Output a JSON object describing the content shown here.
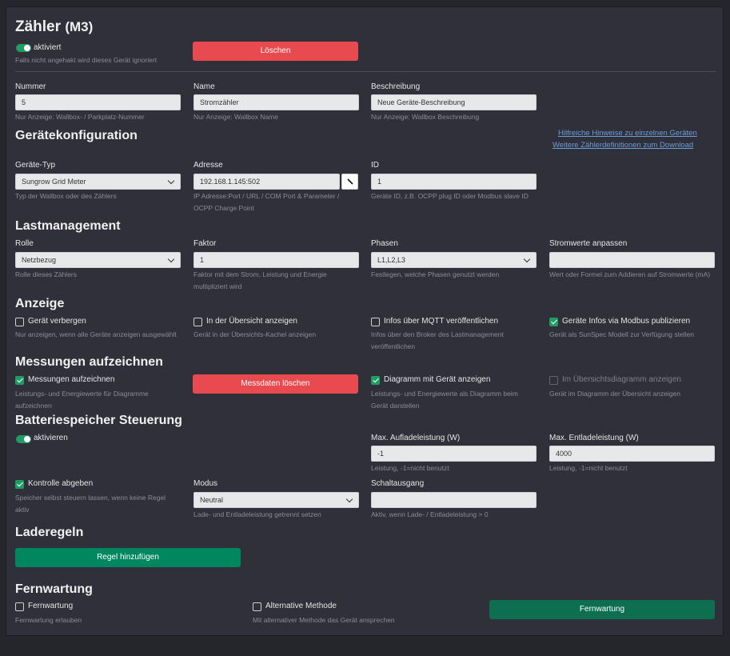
{
  "header": {
    "title": "Zähler",
    "subtitle": "(M3)",
    "toggle_label": "aktiviert",
    "toggle_hint": "Falls nicht angehakt wird dieses Gerät ignoriert",
    "delete_label": "Löschen"
  },
  "general": {
    "nummer": {
      "label": "Nummer",
      "value": "5",
      "hint": "Nur Anzeige: Wallbox- / Parkplatz-Nummer"
    },
    "name": {
      "label": "Name",
      "value": "Stromzähler",
      "hint": "Nur Anzeige: Wallbox Name"
    },
    "beschreibung": {
      "label": "Beschreibung",
      "value": "Neue Geräte-Beschreibung",
      "hint": "Nur Anzeige: Wallbox Beschreibung"
    }
  },
  "config": {
    "heading": "Gerätekonfiguration",
    "link1": "Hilfreiche Hinweise zu einzelnen Geräten",
    "link2": "Weitere Zählerdefinitionen zum Download",
    "typ": {
      "label": "Geräte-Typ",
      "value": "Sungrow Grid Meter",
      "hint": "Typ der Wallbox oder des Zählers"
    },
    "adresse": {
      "label": "Adresse",
      "value": "192.168.1.145:502",
      "hint1": "IP Adresse:Port / URL / COM Port & Parameter /",
      "hint2": "OCPP Charge Point"
    },
    "id": {
      "label": "ID",
      "value": "1",
      "hint": "Geräte ID, z.B. OCPP plug ID oder Modbus slave ID"
    }
  },
  "load": {
    "heading": "Lastmanagement",
    "rolle": {
      "label": "Rolle",
      "value": "Netzbezug",
      "hint": "Rolle dieses Zählers"
    },
    "faktor": {
      "label": "Faktor",
      "value": "1",
      "hint1": "Faktor mit dem Strom, Leistung und Energie",
      "hint2": "multipliziert wird"
    },
    "phasen": {
      "label": "Phasen",
      "value": "L1,L2,L3",
      "hint": "Festlegen, welche Phasen genutzt werden"
    },
    "strom": {
      "label": "Stromwerte anpassen",
      "value": "",
      "hint": "Wert oder Formel zum Addieren auf Stromwerte (mA)"
    }
  },
  "display": {
    "heading": "Anzeige",
    "hide": {
      "label": "Gerät verbergen",
      "hint": "Nur anzeigen, wenn alle Geräte anzeigen ausgewählt"
    },
    "overview": {
      "label": "In der Übersicht anzeigen",
      "hint": "Gerät in der Übersichts-Kachel anzeigen"
    },
    "mqtt": {
      "label": "Infos über MQTT veröffentlichen",
      "hint1": "Infos über den Broker des Lastmanagement",
      "hint2": "veröffentlichen"
    },
    "modbus": {
      "label": "Geräte Infos via Modbus publizieren",
      "hint": "Gerät als SunSpec Modell zur Verfügung stellen"
    }
  },
  "measure": {
    "heading": "Messungen aufzeichnen",
    "record": {
      "label": "Messungen aufzeichnen",
      "hint1": "Leistungs- und Energiewerte für Diagramme",
      "hint2": "aufzeichnen"
    },
    "delete_label": "Messdaten löschen",
    "diagram": {
      "label": "Diagramm mit Gerät anzeigen",
      "hint1": "Leistungs- und Energiewerte als Diagramm beim",
      "hint2": "Gerät darstellen"
    },
    "overview_diagram": {
      "label": "Im Übersichtsdiagramm anzeigen",
      "hint": "Gerät im Diagramm der Übersicht anzeigen"
    }
  },
  "battery": {
    "heading": "Batteriespeicher Steuerung",
    "toggle_label": "aktivieren",
    "max_charge": {
      "label": "Max. Aufladeleistung (W)",
      "value": "-1",
      "hint": "Leistung, -1=nicht benutzt"
    },
    "max_discharge": {
      "label": "Max. Entladeleistung (W)",
      "value": "4000",
      "hint": "Leistung, -1=nicht benutzt"
    },
    "control": {
      "label": "Kontrolle abgeben",
      "hint1": "Speicher selbst steuern lassen, wenn keine Regel",
      "hint2": "aktiv"
    },
    "modus": {
      "label": "Modus",
      "value": "Neutral",
      "hint": "Lade- und Entladeleistung getrennt setzen"
    },
    "output": {
      "label": "Schaltausgang",
      "value": "",
      "hint": "Aktiv, wenn Lade- / Entladeleistung > 0"
    }
  },
  "rules": {
    "heading": "Laderegeln",
    "add_label": "Regel hinzufügen"
  },
  "remote": {
    "heading": "Fernwartung",
    "allow": {
      "label": "Fernwartung",
      "hint": "Fernwartung erlauben"
    },
    "alt": {
      "label": "Alternative Methode",
      "hint": "Mit alternativer Methode das Gerät ansprechen"
    },
    "button_label": "Fernwartung"
  },
  "colors": {
    "panel": "#2f3039",
    "background": "#25262b",
    "danger": "#e84a4f",
    "success": "#00875f",
    "checkbox": "#1f9d64",
    "link": "#6b9dd9"
  }
}
